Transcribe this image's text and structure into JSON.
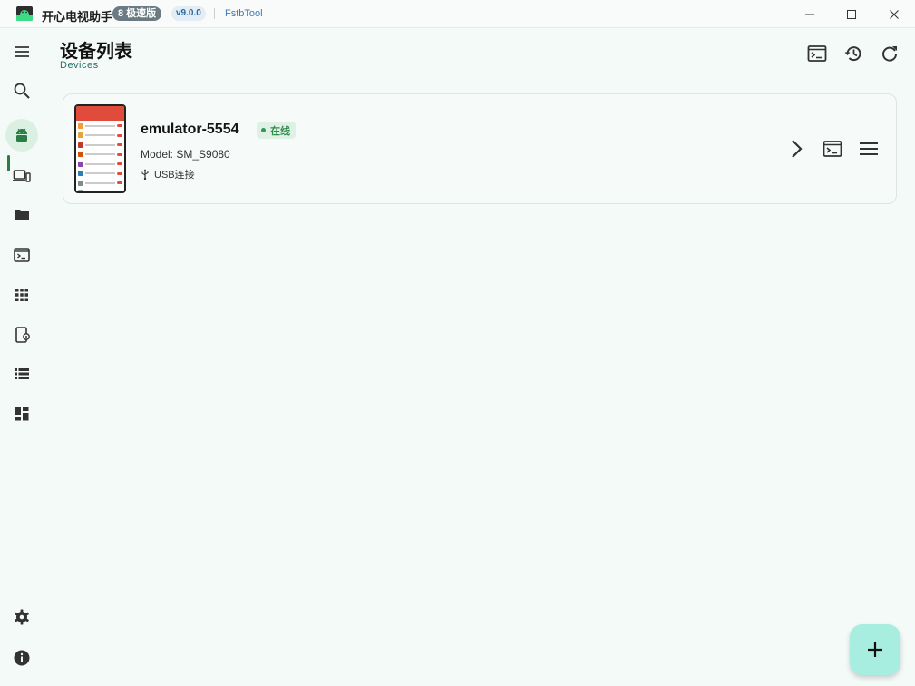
{
  "window": {
    "app_title": "开心电视助手",
    "edition_badge": "8 极速版",
    "version_badge": "v9.0.0",
    "link_text": "FstbTool"
  },
  "sidebar": {
    "items": [
      {
        "icon": "menu-icon"
      },
      {
        "icon": "search-icon"
      },
      {
        "icon": "android-icon",
        "active": true
      },
      {
        "icon": "devices-icon"
      },
      {
        "icon": "folder-icon"
      },
      {
        "icon": "terminal-icon"
      },
      {
        "icon": "apps-grid-icon"
      },
      {
        "icon": "phone-settings-icon"
      },
      {
        "icon": "list-icon"
      },
      {
        "icon": "dashboard-icon"
      },
      {
        "icon": "gear-icon"
      },
      {
        "icon": "info-icon"
      }
    ]
  },
  "header": {
    "title": "设备列表",
    "subtitle": "Devices"
  },
  "device": {
    "name": "emulator-5554",
    "status": "在线",
    "model": "Model: SM_S9080",
    "connection": "USB连接"
  },
  "colors": {
    "accent": "#2a7d45",
    "status_online_bg": "#dff1e4",
    "status_online_text": "#2e8b4a",
    "fab_bg": "#a7eee0",
    "background": "#f4faf7"
  }
}
